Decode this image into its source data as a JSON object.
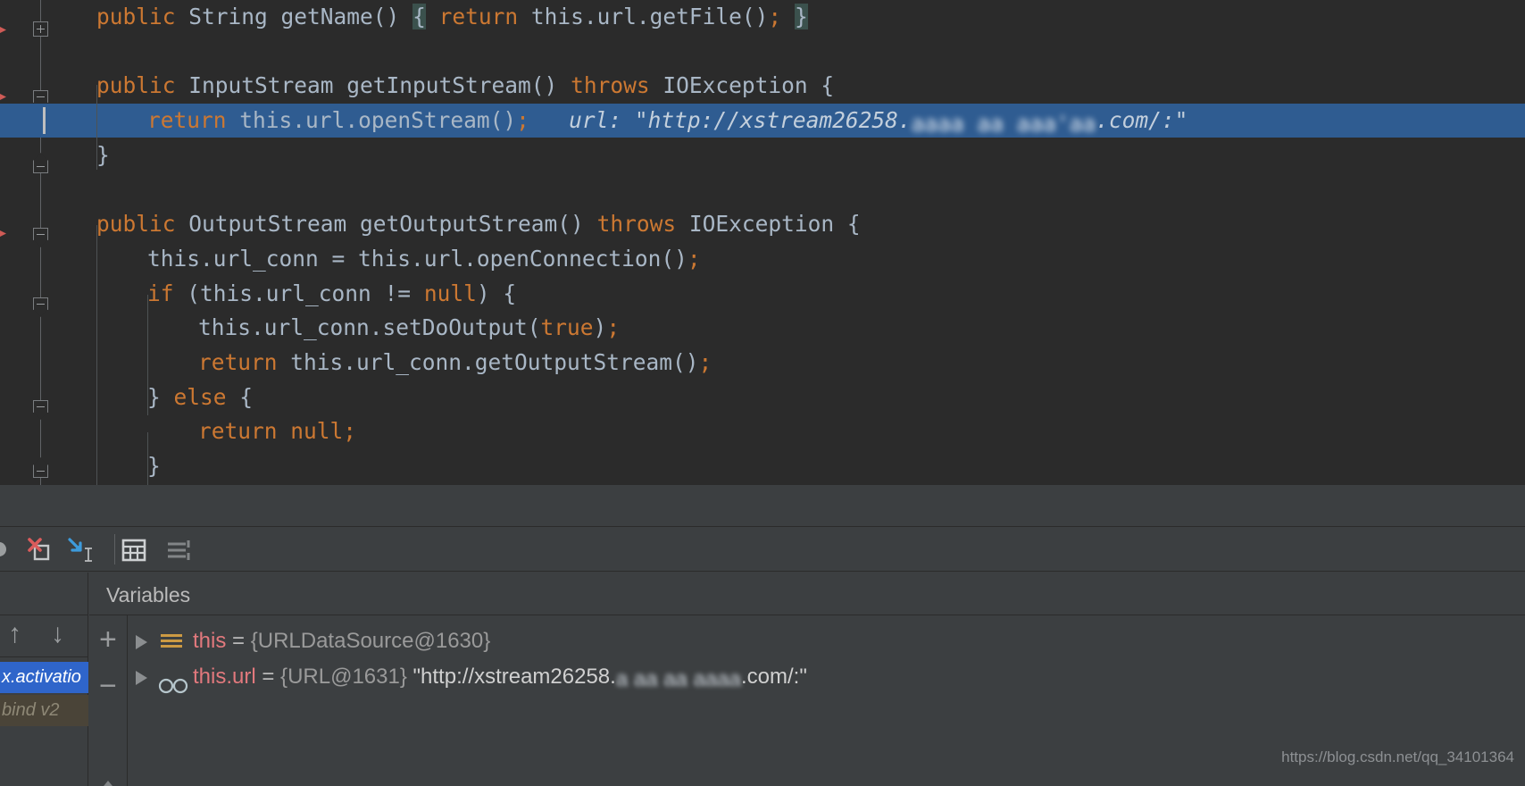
{
  "editor": {
    "lines": [
      {
        "id": "l1",
        "indent": 0,
        "segments": [
          {
            "cls": "kw",
            "t": "public "
          },
          {
            "cls": "ty",
            "t": "String "
          },
          {
            "cls": "fn",
            "t": "getName"
          },
          {
            "cls": "brc",
            "t": "() "
          },
          {
            "cls": "brmatch",
            "t": "{"
          },
          {
            "cls": "brc",
            "t": " "
          },
          {
            "cls": "kw",
            "t": "return "
          },
          {
            "cls": "fld",
            "t": "this"
          },
          {
            "cls": "brc",
            "t": "."
          },
          {
            "cls": "fld",
            "t": "url"
          },
          {
            "cls": "brc",
            "t": ".getFile()"
          },
          {
            "cls": "sem",
            "t": ";"
          },
          {
            "cls": "brc",
            "t": " "
          },
          {
            "cls": "brmatch",
            "t": "}"
          }
        ]
      },
      {
        "id": "l2",
        "indent": 0,
        "segments": [
          {
            "cls": "kw",
            "t": "public "
          },
          {
            "cls": "ty",
            "t": "InputStream "
          },
          {
            "cls": "fn",
            "t": "getInputStream"
          },
          {
            "cls": "brc",
            "t": "() "
          },
          {
            "cls": "kw",
            "t": "throws "
          },
          {
            "cls": "ty",
            "t": "IOException "
          },
          {
            "cls": "brc",
            "t": "{"
          }
        ]
      },
      {
        "id": "l3",
        "indent": 1,
        "highlight": true,
        "segments": [
          {
            "cls": "kw",
            "t": "return "
          },
          {
            "cls": "fld",
            "t": "this"
          },
          {
            "cls": "brc",
            "t": "."
          },
          {
            "cls": "fld",
            "t": "url"
          },
          {
            "cls": "brc",
            "t": ".openStream()"
          },
          {
            "cls": "sem",
            "t": ";"
          },
          {
            "cls": "hint",
            "t": "   url: "
          },
          {
            "cls": "hint",
            "t": "\"http://xstream26258."
          },
          {
            "cls": "blur",
            "t": "aaaa aa aaa'aa"
          },
          {
            "cls": "hint",
            "t": ".com/:\""
          }
        ]
      },
      {
        "id": "l4",
        "indent": 0,
        "segments": [
          {
            "cls": "brc",
            "t": "}"
          }
        ]
      },
      {
        "id": "l5",
        "indent": 0,
        "segments": [
          {
            "cls": "kw",
            "t": "public "
          },
          {
            "cls": "ty",
            "t": "OutputStream "
          },
          {
            "cls": "fn",
            "t": "getOutputStream"
          },
          {
            "cls": "brc",
            "t": "() "
          },
          {
            "cls": "kw",
            "t": "throws "
          },
          {
            "cls": "ty",
            "t": "IOException "
          },
          {
            "cls": "brc",
            "t": "{"
          }
        ]
      },
      {
        "id": "l6",
        "indent": 1,
        "segments": [
          {
            "cls": "fld",
            "t": "this"
          },
          {
            "cls": "brc",
            "t": ".url_conn = "
          },
          {
            "cls": "fld",
            "t": "this"
          },
          {
            "cls": "brc",
            "t": "."
          },
          {
            "cls": "fld",
            "t": "url"
          },
          {
            "cls": "brc",
            "t": ".openConnection()"
          },
          {
            "cls": "sem",
            "t": ";"
          }
        ]
      },
      {
        "id": "l7",
        "indent": 1,
        "segments": [
          {
            "cls": "kw",
            "t": "if "
          },
          {
            "cls": "brc",
            "t": "("
          },
          {
            "cls": "fld",
            "t": "this"
          },
          {
            "cls": "brc",
            "t": ".url_conn != "
          },
          {
            "cls": "kw",
            "t": "null"
          },
          {
            "cls": "brc",
            "t": ") {"
          }
        ]
      },
      {
        "id": "l8",
        "indent": 2,
        "segments": [
          {
            "cls": "fld",
            "t": "this"
          },
          {
            "cls": "brc",
            "t": ".url_conn.setDoOutput("
          },
          {
            "cls": "kw",
            "t": "true"
          },
          {
            "cls": "brc",
            "t": ")"
          },
          {
            "cls": "sem",
            "t": ";"
          }
        ]
      },
      {
        "id": "l9",
        "indent": 2,
        "segments": [
          {
            "cls": "kw",
            "t": "return "
          },
          {
            "cls": "fld",
            "t": "this"
          },
          {
            "cls": "brc",
            "t": ".url_conn.getOutputStream()"
          },
          {
            "cls": "sem",
            "t": ";"
          }
        ]
      },
      {
        "id": "l10",
        "indent": 1,
        "segments": [
          {
            "cls": "brc",
            "t": "} "
          },
          {
            "cls": "kw",
            "t": "else "
          },
          {
            "cls": "brc",
            "t": "{"
          }
        ]
      },
      {
        "id": "l11",
        "indent": 2,
        "segments": [
          {
            "cls": "kw",
            "t": "return "
          },
          {
            "cls": "kw",
            "t": "null"
          },
          {
            "cls": "sem",
            "t": ";"
          }
        ]
      },
      {
        "id": "l12",
        "indent": 1,
        "segments": [
          {
            "cls": "brc",
            "t": "}"
          }
        ]
      }
    ]
  },
  "debug_toolbar": {
    "icons": [
      {
        "name": "mute-breakpoints-icon",
        "label": "Mute Breakpoints"
      },
      {
        "name": "view-breakpoints-icon",
        "label": "View Breakpoints"
      },
      {
        "name": "evaluate-expression-icon",
        "label": "Evaluate Expression"
      },
      {
        "name": "layout-settings-icon",
        "label": "Layout Settings"
      },
      {
        "name": "settings-list-icon",
        "label": "Settings"
      }
    ]
  },
  "frames": {
    "up_label": "↑",
    "down_label": "↓",
    "rows": [
      {
        "label": "x.activatio",
        "selected": true
      },
      {
        "label": "bind v2",
        "selected": false
      }
    ]
  },
  "variables": {
    "title": "Variables",
    "add_label": "+",
    "remove_label": "−",
    "rows": [
      {
        "icon": "field-icon",
        "name": "this",
        "eq": " = ",
        "value": "{URLDataSource@1630}",
        "string_value": "",
        "blurred": ""
      },
      {
        "icon": "glasses-icon",
        "name": "this.url",
        "eq": " = ",
        "value": "{URL@1631} ",
        "string_prefix": "\"http://xstream26258.",
        "blurred": "a aa aa  aaaa",
        "string_suffix": ".com/:\""
      }
    ]
  },
  "watermark": {
    "text": "https://blog.csdn.net/qq_34101364"
  },
  "colors": {
    "editor_bg": "#2b2b2b",
    "panel_bg": "#3c3f41",
    "selection_blue": "#2f5c91",
    "keyword_orange": "#cc7832",
    "text_gray": "#a9b7c6",
    "var_name_red": "#e2797d",
    "field_icon_gold": "#cc9a43",
    "frame_selected": "#2f65ca"
  }
}
